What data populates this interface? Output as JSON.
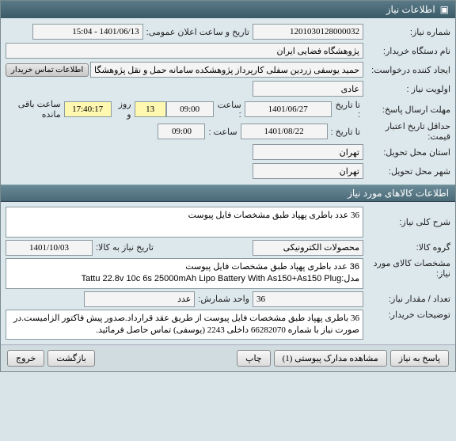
{
  "window": {
    "title": "اطلاعات نیاز"
  },
  "sections": {
    "need_items": "اطلاعات کالاهای مورد نیاز"
  },
  "labels": {
    "need_no": "شماره نیاز:",
    "announce_dt": "تاریخ و ساعت اعلان عمومی:",
    "buyer_org": "نام دستگاه خریدار:",
    "request_creator": "ایجاد کننده درخواست:",
    "contact_info": "اطلاعات تماس خریدار",
    "priority": "اولویت نیاز :",
    "reply_deadline": "مهلت ارسال پاسخ:",
    "to_date": "تا تاریخ :",
    "at_time": "ساعت :",
    "price_validity": "حداقل تاریخ اعتبار قیمت:",
    "delivery_province": "استان محل تحویل:",
    "delivery_city": "شهر محل تحویل:",
    "day_and": "روز و",
    "hours_remain": "ساعت باقی مانده",
    "need_desc": "شرح کلی نیاز:",
    "goods_group": "گروه کالا:",
    "need_date": "تاریخ نیاز به کالا:",
    "goods_spec": "مشخصات کالای مورد نیاز:",
    "qty": "تعداد / مقدار نیاز:",
    "unit": "واحد شمارش:",
    "buyer_notes": "توضیحات خریدار:"
  },
  "fields": {
    "need_no": "1201030128000032",
    "announce_dt": "1401/06/13 - 15:04",
    "buyer_org": "پژوهشگاه فضایی ایران",
    "request_creator": "حمید یوسفی زردین سفلی کارپرداز پژوهشکده سامانه حمل و نقل پژوهشگاه ف",
    "priority": "عادی",
    "reply_to_date": "1401/06/27",
    "reply_to_time": "09:00",
    "price_to_date": "1401/08/22",
    "price_to_time": "09:00",
    "remain_days": "13",
    "remain_time": "17:40:17",
    "delivery_province": "تهران",
    "delivery_city": "تهران",
    "need_desc": "36 عدد باطری پهپاد طبق مشخصات فایل پیوست",
    "goods_group": "محصولات الکترونیکی",
    "need_date": "1401/10/03",
    "goods_spec_line1": "36 عدد باطری پهپاد طبق مشخصات فایل پیوست",
    "goods_spec_line2_label": "مدل:",
    "goods_spec_line2_val": "Tattu 22.8v 10c 6s 25000mAh Lipo Battery With As150+As150 Plug",
    "qty": "36",
    "unit": "عدد",
    "buyer_notes": "36 باطری پهپاد طبق مشخصات فایل پیوست از طریق عقد قرارداد.صدور پیش فاکتور الزامیست.در صورت نیاز با شماره 66282070 داخلی 2243 (یوسفی) تماس حاصل فرمائید."
  },
  "buttons": {
    "reply": "پاسخ به نیاز",
    "attachments": "مشاهده مدارک پیوستی (1)",
    "print": "چاپ",
    "back": "بازگشت",
    "exit": "خروج"
  }
}
